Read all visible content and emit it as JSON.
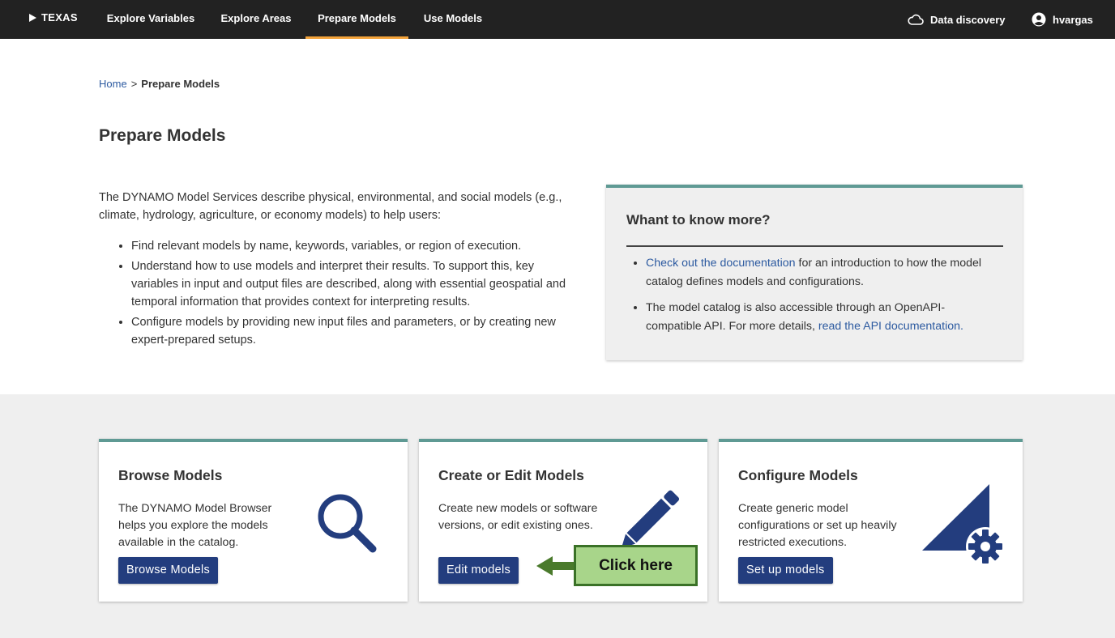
{
  "nav": {
    "brand": "TEXAS",
    "tabs": [
      "Explore Variables",
      "Explore Areas",
      "Prepare Models",
      "Use Models"
    ],
    "active_tab": "Prepare Models",
    "data_discovery": "Data discovery",
    "user": "hvargas",
    "accent_color": "#f3a33a"
  },
  "breadcrumb": {
    "home": "Home",
    "separator": ">",
    "current": "Prepare Models"
  },
  "page_title": "Prepare Models",
  "intro": {
    "text": "The DYNAMO Model Services describe physical, environmental, and social models (e.g., climate, hydrology, agriculture, or economy models) to help users:",
    "bullets": [
      "Find relevant models by name, keywords, variables, or region of execution.",
      "Understand how to use models and interpret their results. To support this, key variables in input and output files are described, along with essential geospatial and temporal information that provides context for interpreting results.",
      "Configure models by providing new input files and parameters, or by creating new expert-prepared setups."
    ]
  },
  "info_box": {
    "title": "Whant to know more?",
    "item1_link": "Check out the documentation",
    "item1_text": " for an introduction to how the model catalog defines models and configurations.",
    "item2_text": "The model catalog is also accessible through an OpenAPI-compatible API. For more details, ",
    "item2_link": "read the API documentation."
  },
  "cards": [
    {
      "title": "Browse Models",
      "text": "The DYNAMO Model Browser helps you explore the models available in the catalog.",
      "button": "Browse Models",
      "icon": "magnifier-icon"
    },
    {
      "title": "Create or Edit Models",
      "text": "Create new models or software versions, or edit existing ones.",
      "button": "Edit models",
      "icon": "pencil-icon"
    },
    {
      "title": "Configure Models",
      "text": "Create generic model configurations or set up heavily restricted executions.",
      "button": "Set up models",
      "icon": "triangle-gear-icon"
    }
  ],
  "callout": {
    "label": "Click here",
    "color": "#a8d58a",
    "border": "#3a7127"
  },
  "colors": {
    "primary": "#233d7e",
    "teal": "#5f9a94",
    "link": "#2c5aa0",
    "nav_bg": "#222222"
  }
}
